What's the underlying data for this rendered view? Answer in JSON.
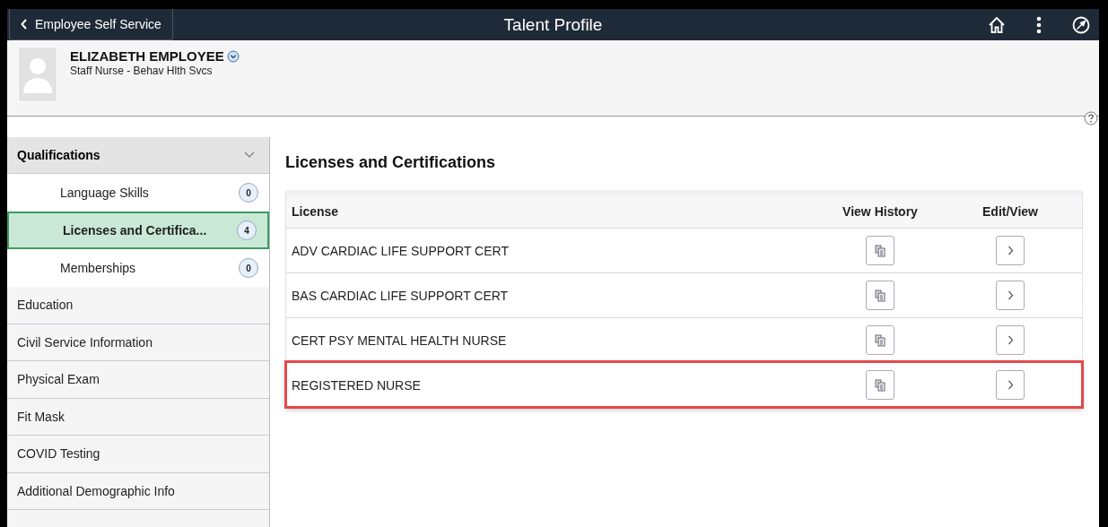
{
  "header": {
    "back_label": "Employee Self Service",
    "title": "Talent Profile"
  },
  "profile": {
    "name": "ELIZABETH EMPLOYEE",
    "job": "Staff Nurse - Behav Hlth Svcs"
  },
  "sidebar": {
    "section": {
      "label": "Qualifications",
      "expanded": true,
      "children": [
        {
          "label": "Language Skills",
          "count": "0",
          "selected": false
        },
        {
          "label": "Licenses and Certifica...",
          "count": "4",
          "selected": true
        },
        {
          "label": "Memberships",
          "count": "0",
          "selected": false
        }
      ]
    },
    "items": [
      {
        "label": "Education"
      },
      {
        "label": "Civil Service Information"
      },
      {
        "label": "Physical Exam"
      },
      {
        "label": "Fit Mask"
      },
      {
        "label": "COVID Testing"
      },
      {
        "label": "Additional Demographic Info"
      }
    ]
  },
  "main": {
    "title": "Licenses and Certifications",
    "table": {
      "columns": [
        "License",
        "View History",
        "Edit/View"
      ],
      "rows": [
        {
          "license": "ADV CARDIAC LIFE SUPPORT CERT",
          "highlighted": false
        },
        {
          "license": "BAS CARDIAC LIFE SUPPORT CERT",
          "highlighted": false
        },
        {
          "license": "CERT PSY MENTAL HEALTH NURSE",
          "highlighted": false
        },
        {
          "license": "REGISTERED NURSE",
          "highlighted": true
        }
      ]
    }
  }
}
